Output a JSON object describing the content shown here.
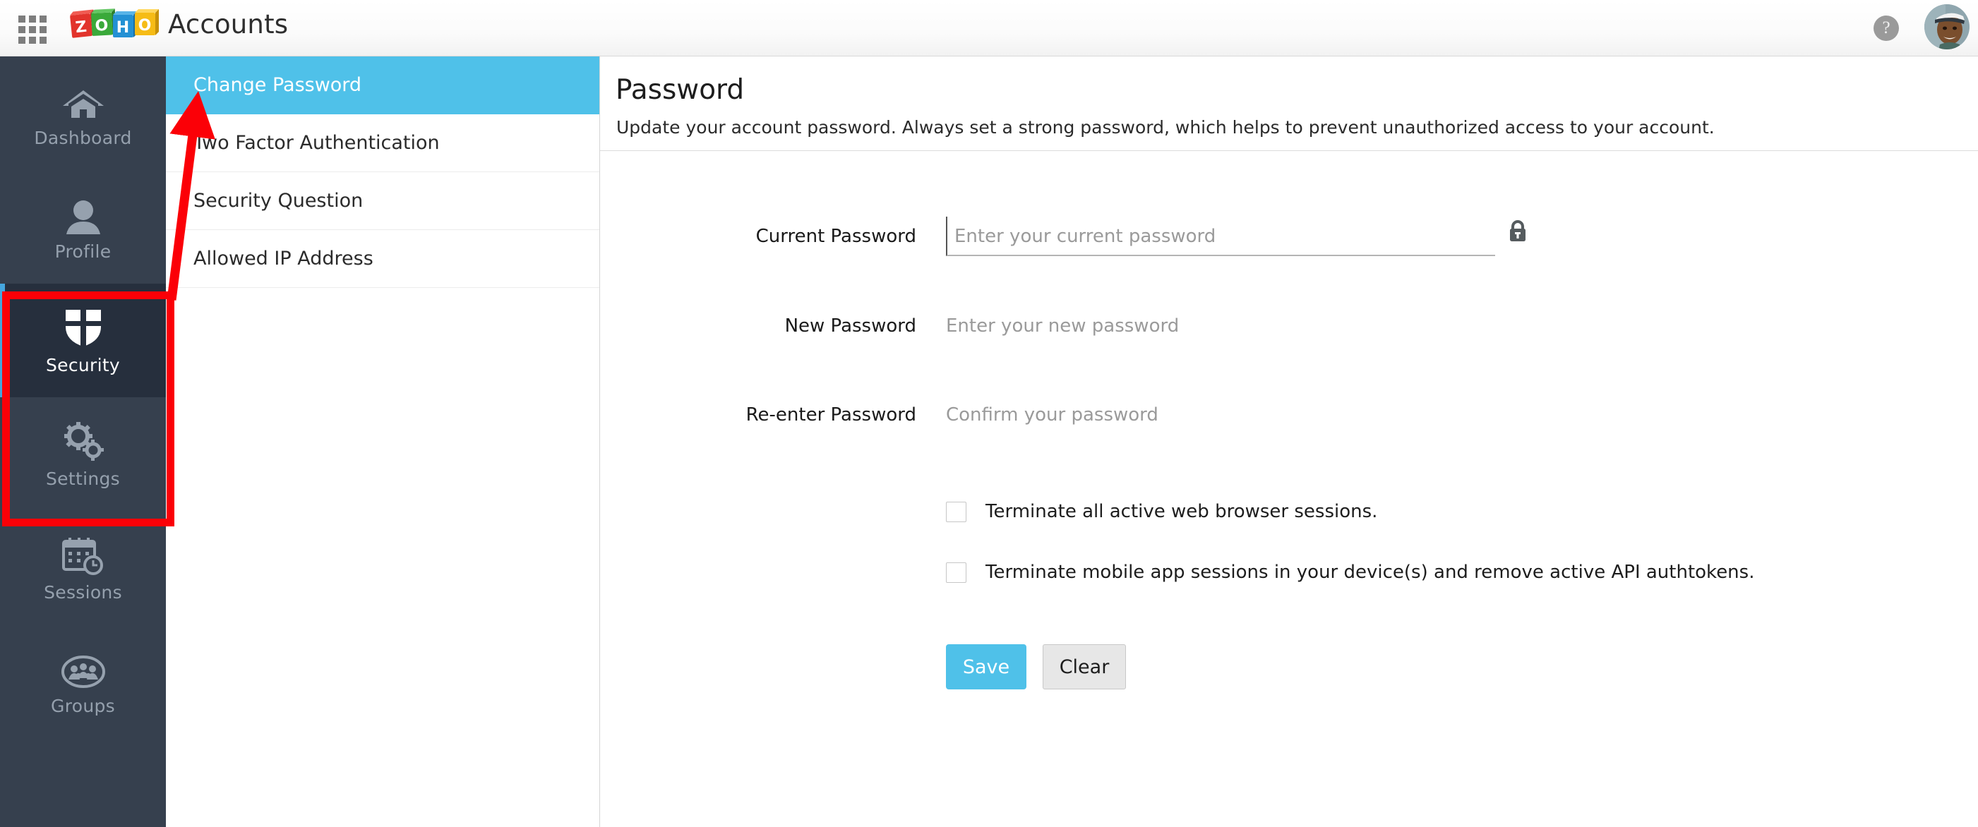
{
  "topbar": {
    "apps_icon": "apps-grid-icon",
    "logo_text": "ZOHO",
    "app_title": "Accounts",
    "help_icon_label": "?",
    "avatar_label": "user-avatar"
  },
  "sidebar": {
    "items": [
      {
        "label": "Dashboard",
        "icon": "home-icon",
        "active": false
      },
      {
        "label": "Profile",
        "icon": "person-icon",
        "active": false
      },
      {
        "label": "Security",
        "icon": "shield-icon",
        "active": true
      },
      {
        "label": "Settings",
        "icon": "gears-icon",
        "active": false
      },
      {
        "label": "Sessions",
        "icon": "calendar-clock-icon",
        "active": false
      },
      {
        "label": "Groups",
        "icon": "people-group-icon",
        "active": false
      }
    ]
  },
  "subnav": {
    "items": [
      {
        "label": "Change Password",
        "active": true
      },
      {
        "label": "Two Factor Authentication",
        "active": false
      },
      {
        "label": "Security Question",
        "active": false
      },
      {
        "label": "Allowed IP Address",
        "active": false
      }
    ]
  },
  "main": {
    "title": "Password",
    "subtitle": "Update your account password. Always set a strong password, which helps to prevent unauthorized access to your account.",
    "fields": [
      {
        "label": "Current Password",
        "value": "",
        "placeholder": "Enter your current password",
        "focused": true,
        "icon": "lock-icon"
      },
      {
        "label": "New Password",
        "value": "",
        "placeholder": "Enter your new password",
        "focused": false
      },
      {
        "label": "Re-enter Password",
        "value": "",
        "placeholder": "Confirm your password",
        "focused": false
      }
    ],
    "checkboxes": [
      {
        "label": "Terminate all active web browser sessions.",
        "checked": false
      },
      {
        "label": "Terminate mobile app sessions in your device(s) and remove active API authtokens.",
        "checked": false
      }
    ],
    "buttons": {
      "save_label": "Save",
      "clear_label": "Clear"
    }
  },
  "annotations": {
    "highlight_target": "Security",
    "arrow_target": "Change Password",
    "color": "#fb0007"
  },
  "colors": {
    "accent_blue": "#4fc1e9",
    "sidebar_bg": "#36404e",
    "sidebar_active_bg": "#262f3d",
    "sidebar_active_bar": "#45a6de",
    "annotation_red": "#fb0007"
  }
}
